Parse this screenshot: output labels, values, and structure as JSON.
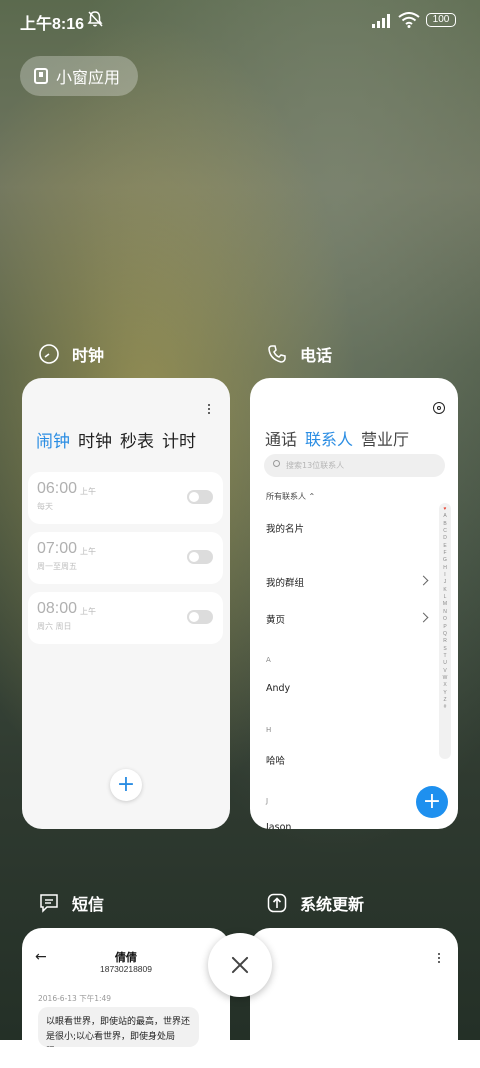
{
  "status_bar": {
    "time": "上午8:16",
    "battery": "100"
  },
  "small_window_chip": {
    "label": "小窗应用"
  },
  "apps": {
    "clock": {
      "title": "时钟",
      "tabs": [
        "闹钟",
        "时钟",
        "秒表",
        "计时"
      ],
      "active_tab": "闹钟",
      "alarms": [
        {
          "time": "06:00",
          "ampm": "上午",
          "repeat": "每天",
          "enabled": false
        },
        {
          "time": "07:00",
          "ampm": "上午",
          "repeat": "周一至周五",
          "enabled": false
        },
        {
          "time": "08:00",
          "ampm": "上午",
          "repeat": "周六 周日",
          "enabled": false
        }
      ],
      "add_label": "+"
    },
    "phone": {
      "title": "电话",
      "tabs": [
        "通话",
        "联系人",
        "营业厅"
      ],
      "active_tab": "联系人",
      "search_placeholder": "搜索13位联系人",
      "all_contacts": "所有联系人",
      "rows": [
        "我的名片",
        "我的群组",
        "黄页"
      ],
      "sections": [
        {
          "letter": "A",
          "name": "Andy"
        },
        {
          "letter": "H",
          "name": "哈哈"
        },
        {
          "letter": "J",
          "name": "Jason"
        }
      ],
      "index": [
        "♥",
        "A",
        "B",
        "C",
        "D",
        "E",
        "F",
        "G",
        "H",
        "I",
        "J",
        "K",
        "L",
        "M",
        "N",
        "O",
        "P",
        "Q",
        "R",
        "S",
        "T",
        "U",
        "V",
        "W",
        "X",
        "Y",
        "Z",
        "#"
      ],
      "add_label": "+"
    },
    "sms": {
      "title": "短信",
      "contact_name": "倩倩",
      "contact_number": "18730218809",
      "date": "2016-6-13 下午1:49",
      "message": "以眼看世界，即使站的最高，世界还是很小;以心看世界，即使身处局限，"
    },
    "update": {
      "title": "系统更新"
    }
  },
  "colors": {
    "accent": "#2b8de3",
    "fab": "#1e90ef"
  }
}
